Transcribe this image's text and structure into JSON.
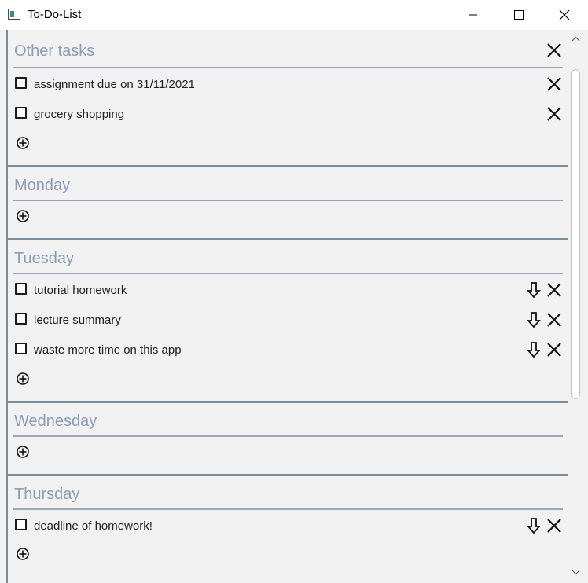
{
  "window": {
    "title": "To-Do-List"
  },
  "sections": [
    {
      "name": "Other tasks",
      "tasks": [
        {
          "text": "assignment due on 31/11/2021"
        },
        {
          "text": "grocery shopping"
        }
      ]
    },
    {
      "name": "Monday",
      "tasks": []
    },
    {
      "name": "Tuesday",
      "tasks": [
        {
          "text": "tutorial homework"
        },
        {
          "text": "lecture summary"
        },
        {
          "text": "waste more time on this app"
        }
      ]
    },
    {
      "name": "Wednesday",
      "tasks": []
    },
    {
      "name": "Thursday",
      "tasks": [
        {
          "text": "deadline of homework!"
        }
      ]
    }
  ],
  "icons": {
    "delete": "close-x-icon",
    "move_down": "arrow-down-icon",
    "add": "add-circle-icon"
  },
  "colors": {
    "section_title": "#8a9db5",
    "separator": "#7b8a97",
    "background": "#f1f1f1"
  }
}
